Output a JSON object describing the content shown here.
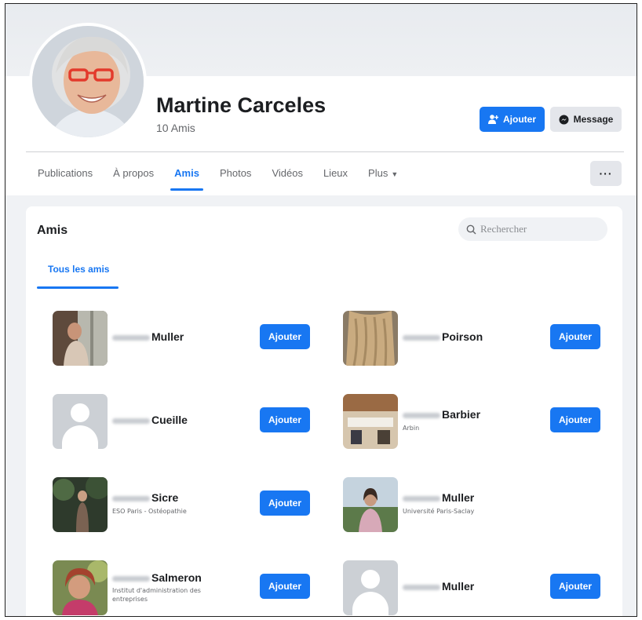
{
  "profile": {
    "name": "Martine Carceles",
    "friend_count": "10 Amis",
    "add_button": "Ajouter",
    "message_button": "Message",
    "more_button": "···"
  },
  "tabs": [
    {
      "label": "Publications"
    },
    {
      "label": "À propos"
    },
    {
      "label": "Amis"
    },
    {
      "label": "Photos"
    },
    {
      "label": "Vidéos"
    },
    {
      "label": "Lieux"
    },
    {
      "label": "Plus"
    }
  ],
  "friends_section": {
    "title": "Amis",
    "search_placeholder": "Rechercher",
    "subtab": "Tous les amis"
  },
  "friends": [
    {
      "name": "Muller",
      "subtitle": "",
      "button": "Ajouter"
    },
    {
      "name": "Poirson",
      "subtitle": "",
      "button": "Ajouter"
    },
    {
      "name": "Cueille",
      "subtitle": "",
      "button": "Ajouter"
    },
    {
      "name": "Barbier",
      "subtitle": "Arbin",
      "button": "Ajouter"
    },
    {
      "name": "Sicre",
      "subtitle": "ESO Paris - Ostéopathie",
      "button": "Ajouter"
    },
    {
      "name": "Muller",
      "subtitle": "Université Paris-Saclay",
      "button": "Ajouter"
    },
    {
      "name": "Salmeron",
      "subtitle": "Institut d'administration des entreprises",
      "button": "Ajouter"
    },
    {
      "name": "Muller",
      "subtitle": "",
      "button": "Ajouter"
    }
  ],
  "colors": {
    "accent": "#1877f2",
    "secondary_button": "#e4e6eb",
    "page_background": "#f0f2f5"
  },
  "icons": [
    "add-friend-icon",
    "messenger-icon",
    "search-icon",
    "chevron-down-icon",
    "default-avatar-icon"
  ]
}
